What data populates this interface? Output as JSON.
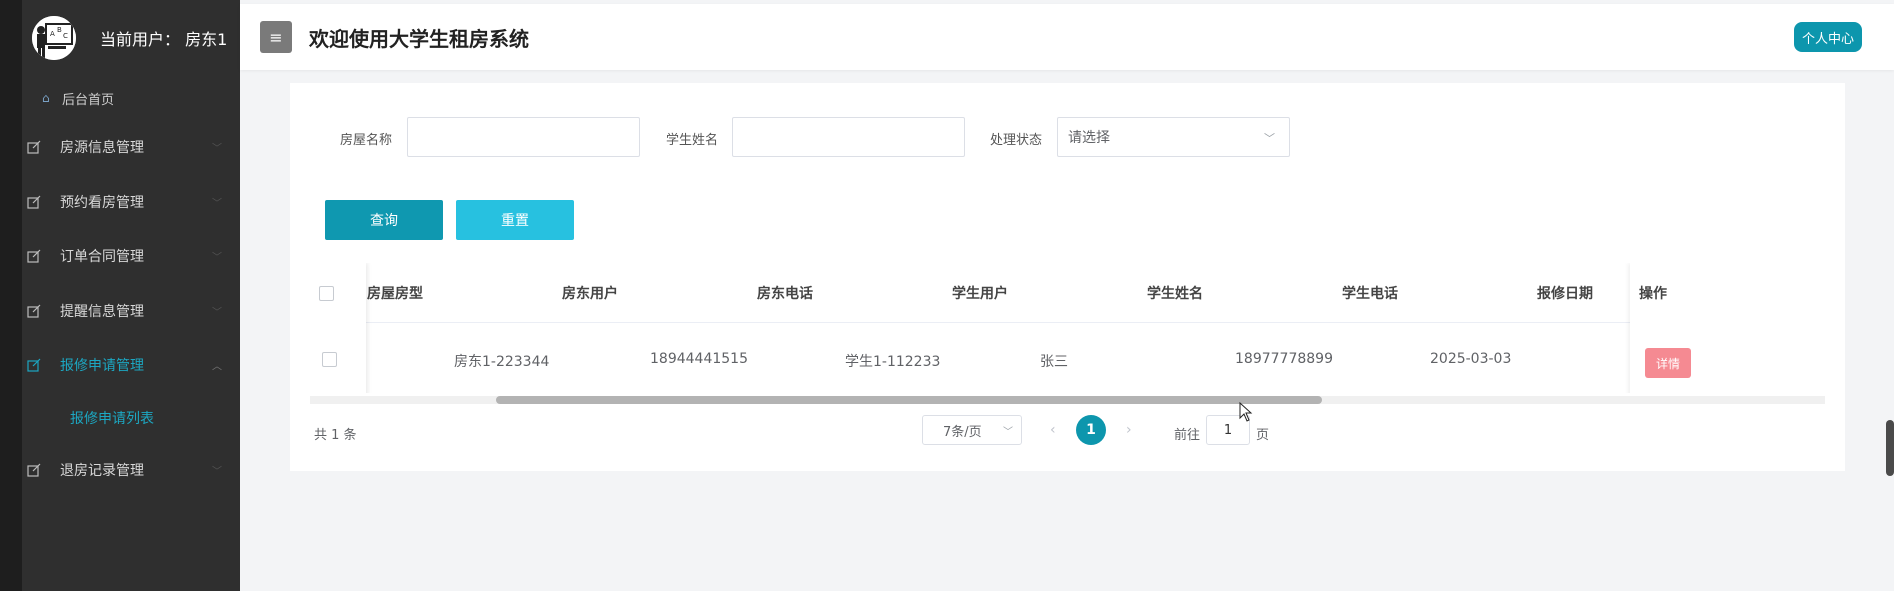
{
  "sidebar": {
    "user_label": "当前用户：  房东1",
    "home": "后台首页",
    "items": [
      {
        "label": "房源信息管理",
        "icon": "edit-icon"
      },
      {
        "label": "预约看房管理",
        "icon": "edit-icon"
      },
      {
        "label": "订单合同管理",
        "icon": "edit-icon"
      },
      {
        "label": "提醒信息管理",
        "icon": "edit-icon"
      },
      {
        "label": "报修申请管理",
        "icon": "edit-icon",
        "active": true
      },
      {
        "label": "退房记录管理",
        "icon": "edit-icon"
      }
    ],
    "sub_item": "报修申请列表",
    "accent_color": "#1ca7c2"
  },
  "header": {
    "title": "欢迎使用大学生租房系统",
    "personal_center": "个人中心"
  },
  "filters": {
    "house_name_label": "房屋名称",
    "student_name_label": "学生姓名",
    "status_label": "处理状态",
    "status_placeholder": "请选择",
    "query_button": "查询",
    "reset_button": "重置"
  },
  "table": {
    "columns": [
      "房屋房型",
      "房东用户",
      "房东电话",
      "学生用户",
      "学生姓名",
      "学生电话",
      "报修日期",
      "操作"
    ],
    "rows": [
      {
        "landlord_user": "房东1-223344",
        "landlord_phone": "18944441515",
        "student_user": "学生1-112233",
        "student_name": "张三",
        "student_phone": "18977778899",
        "repair_date": "2025-03-03",
        "action": "详情"
      }
    ]
  },
  "pagination": {
    "total": "共 1 条",
    "page_size": "7条/页",
    "current_page": "1",
    "goto_prefix": "前往",
    "goto_value": "1",
    "goto_suffix": "页"
  }
}
